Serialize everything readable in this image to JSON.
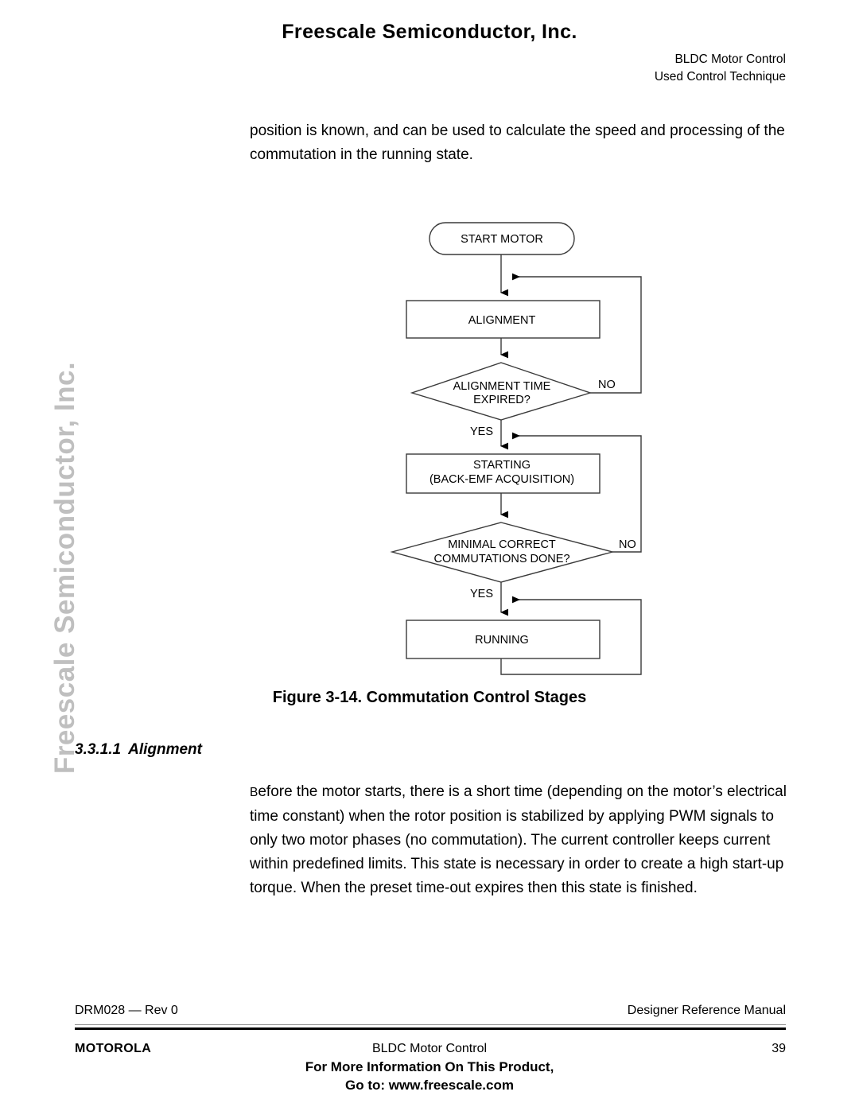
{
  "header": {
    "brand": "Freescale Semiconductor, Inc.",
    "doc_title": "BLDC Motor Control",
    "doc_subtitle": "Used Control Technique"
  },
  "watermark": {
    "vertical_text": "Freescale Semiconductor, Inc.",
    "color": "#bfbfbf"
  },
  "body": {
    "intro_paragraph": "position is known, and can be used to calculate the speed and processing of the commutation in the running state.",
    "section": {
      "number": "3.3.1.1",
      "title": "Alignment"
    },
    "alignment_paragraph_lead": "B",
    "alignment_paragraph": "efore the motor starts, there is a short time (depending on the motor’s electrical time constant) when the rotor position is stabilized by applying PWM signals to only two motor phases (no commutation). The current controller keeps current within predefined limits. This state is necessary in order to create a high start-up torque. When the preset time-out expires then this state is finished."
  },
  "figure": {
    "caption": "Figure 3-14. Commutation Control Stages",
    "nodes": {
      "start": "START MOTOR",
      "alignment": "ALIGNMENT",
      "decision1_line1": "ALIGNMENT TIME",
      "decision1_line2": "EXPIRED?",
      "starting_line1": "STARTING",
      "starting_line2": "(BACK-EMF ACQUISITION)",
      "decision2_line1": "MINIMAL CORRECT",
      "decision2_line2": "COMMUTATIONS DONE?",
      "running": "RUNNING"
    },
    "edge_labels": {
      "d1_no": "NO",
      "d1_yes": "YES",
      "d2_no": "NO",
      "d2_yes": "YES"
    },
    "stroke_color": "#3a3a3a"
  },
  "footer": {
    "doc_id": "DRM028 — Rev 0",
    "manual_type": "Designer Reference Manual",
    "company": "MOTOROLA",
    "running_title": "BLDC Motor Control",
    "page_number": "39",
    "promo_line1": "For More Information On This Product,",
    "promo_line2": "Go to: www.freescale.com"
  }
}
